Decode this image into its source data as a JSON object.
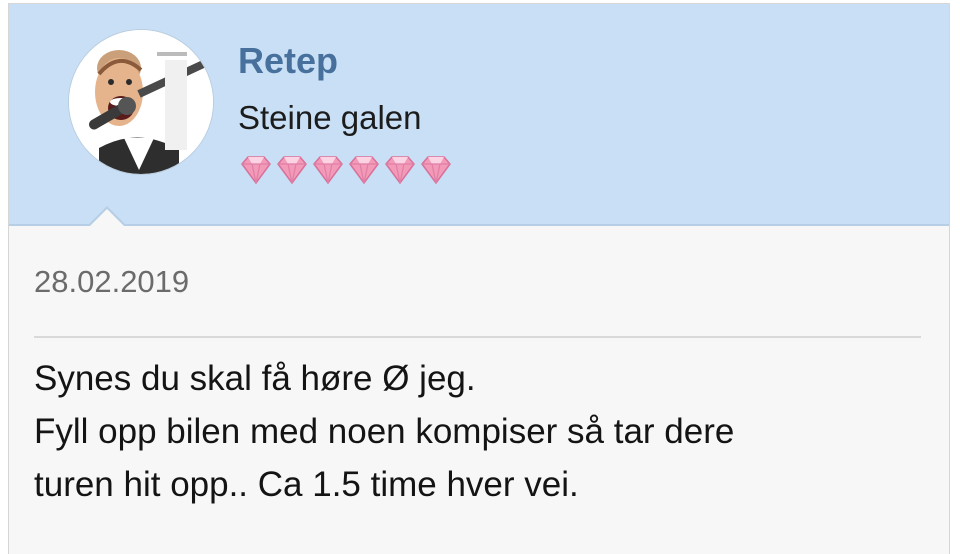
{
  "post": {
    "author": {
      "name": "Retep",
      "title": "Steine galen",
      "rank_gems": 6,
      "rank_gem_color": "#f29ab8"
    },
    "date": "28.02.2019",
    "message_lines": [
      "Synes du skal få høre Ø jeg.",
      "Fyll opp bilen med noen kompiser så tar dere",
      "turen hit opp.. Ca 1.5 time hver vei."
    ]
  },
  "colors": {
    "author_bar_bg": "#c8dff5",
    "username": "#47709c",
    "body_bg": "#f7f7f7"
  },
  "icons": {
    "avatar": "caricature-singer-avatar",
    "rank": "pink-gem-icon"
  }
}
